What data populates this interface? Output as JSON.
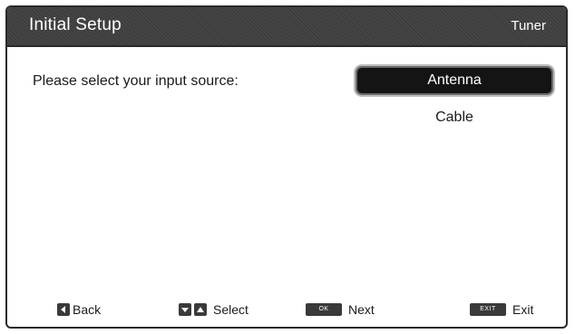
{
  "header": {
    "title": "Initial Setup",
    "section": "Tuner"
  },
  "main": {
    "prompt": "Please select your input source:",
    "options": [
      {
        "label": "Antenna",
        "selected": true
      },
      {
        "label": "Cable",
        "selected": false
      }
    ]
  },
  "footer": {
    "back": {
      "icon": "left-arrow-key-icon",
      "label": "Back"
    },
    "select": {
      "icons": [
        "down-arrow-key-icon",
        "up-arrow-key-icon"
      ],
      "label": "Select"
    },
    "next": {
      "icon": "ok-key-icon",
      "key_text": "OK",
      "label": "Next"
    },
    "exit": {
      "icon": "exit-key-icon",
      "key_text": "EXIT",
      "label": "Exit"
    }
  },
  "colors": {
    "title_bar": "#3e3e3e",
    "selected_option_bg": "#141414",
    "selected_option_text": "#ffffff",
    "text": "#1a1a1a",
    "background": "#ffffff"
  }
}
